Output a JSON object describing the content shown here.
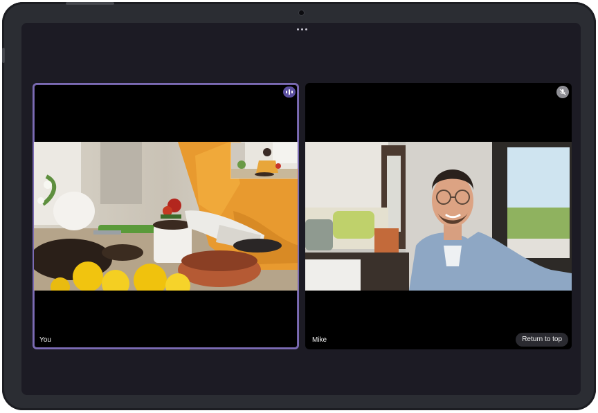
{
  "participants": {
    "you": {
      "name": "You",
      "status": "speaking"
    },
    "mike": {
      "name": "Mike",
      "status": "muted"
    }
  },
  "actions": {
    "return_to_top": "Return to top"
  },
  "colors": {
    "speaking_accent": "#7b6bb3",
    "screen_bg": "#1c1b24",
    "tile_bg": "#000000"
  },
  "icons": [
    "speaking-indicator-icon",
    "mic-off-icon",
    "more-options-icon",
    "camera-icon"
  ]
}
